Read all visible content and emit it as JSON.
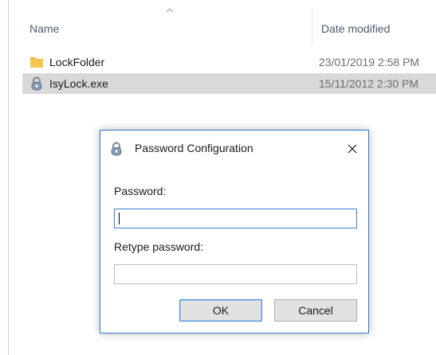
{
  "explorer": {
    "columns": {
      "name": "Name",
      "date_modified": "Date modified"
    },
    "sort_icon": "chevron-up-icon",
    "files": [
      {
        "name": "LockFolder",
        "date": "23/01/2019 2:58 PM",
        "icon": "folder-icon",
        "selected": false
      },
      {
        "name": "IsyLock.exe",
        "date": "15/11/2012 2:30 PM",
        "icon": "padlock-icon",
        "selected": true
      }
    ]
  },
  "dialog": {
    "title": "Password Configuration",
    "icon": "padlock-icon",
    "close_icon": "close-icon",
    "password_label": "Password:",
    "password_value": "",
    "retype_label": "Retype password:",
    "retype_value": "",
    "ok_label": "OK",
    "cancel_label": "Cancel"
  },
  "colors": {
    "selection": "#d9d9d9",
    "dialog_border": "#2b79d4",
    "focus_border": "#3c7fd1",
    "folder_yellow": "#f4c84f"
  }
}
